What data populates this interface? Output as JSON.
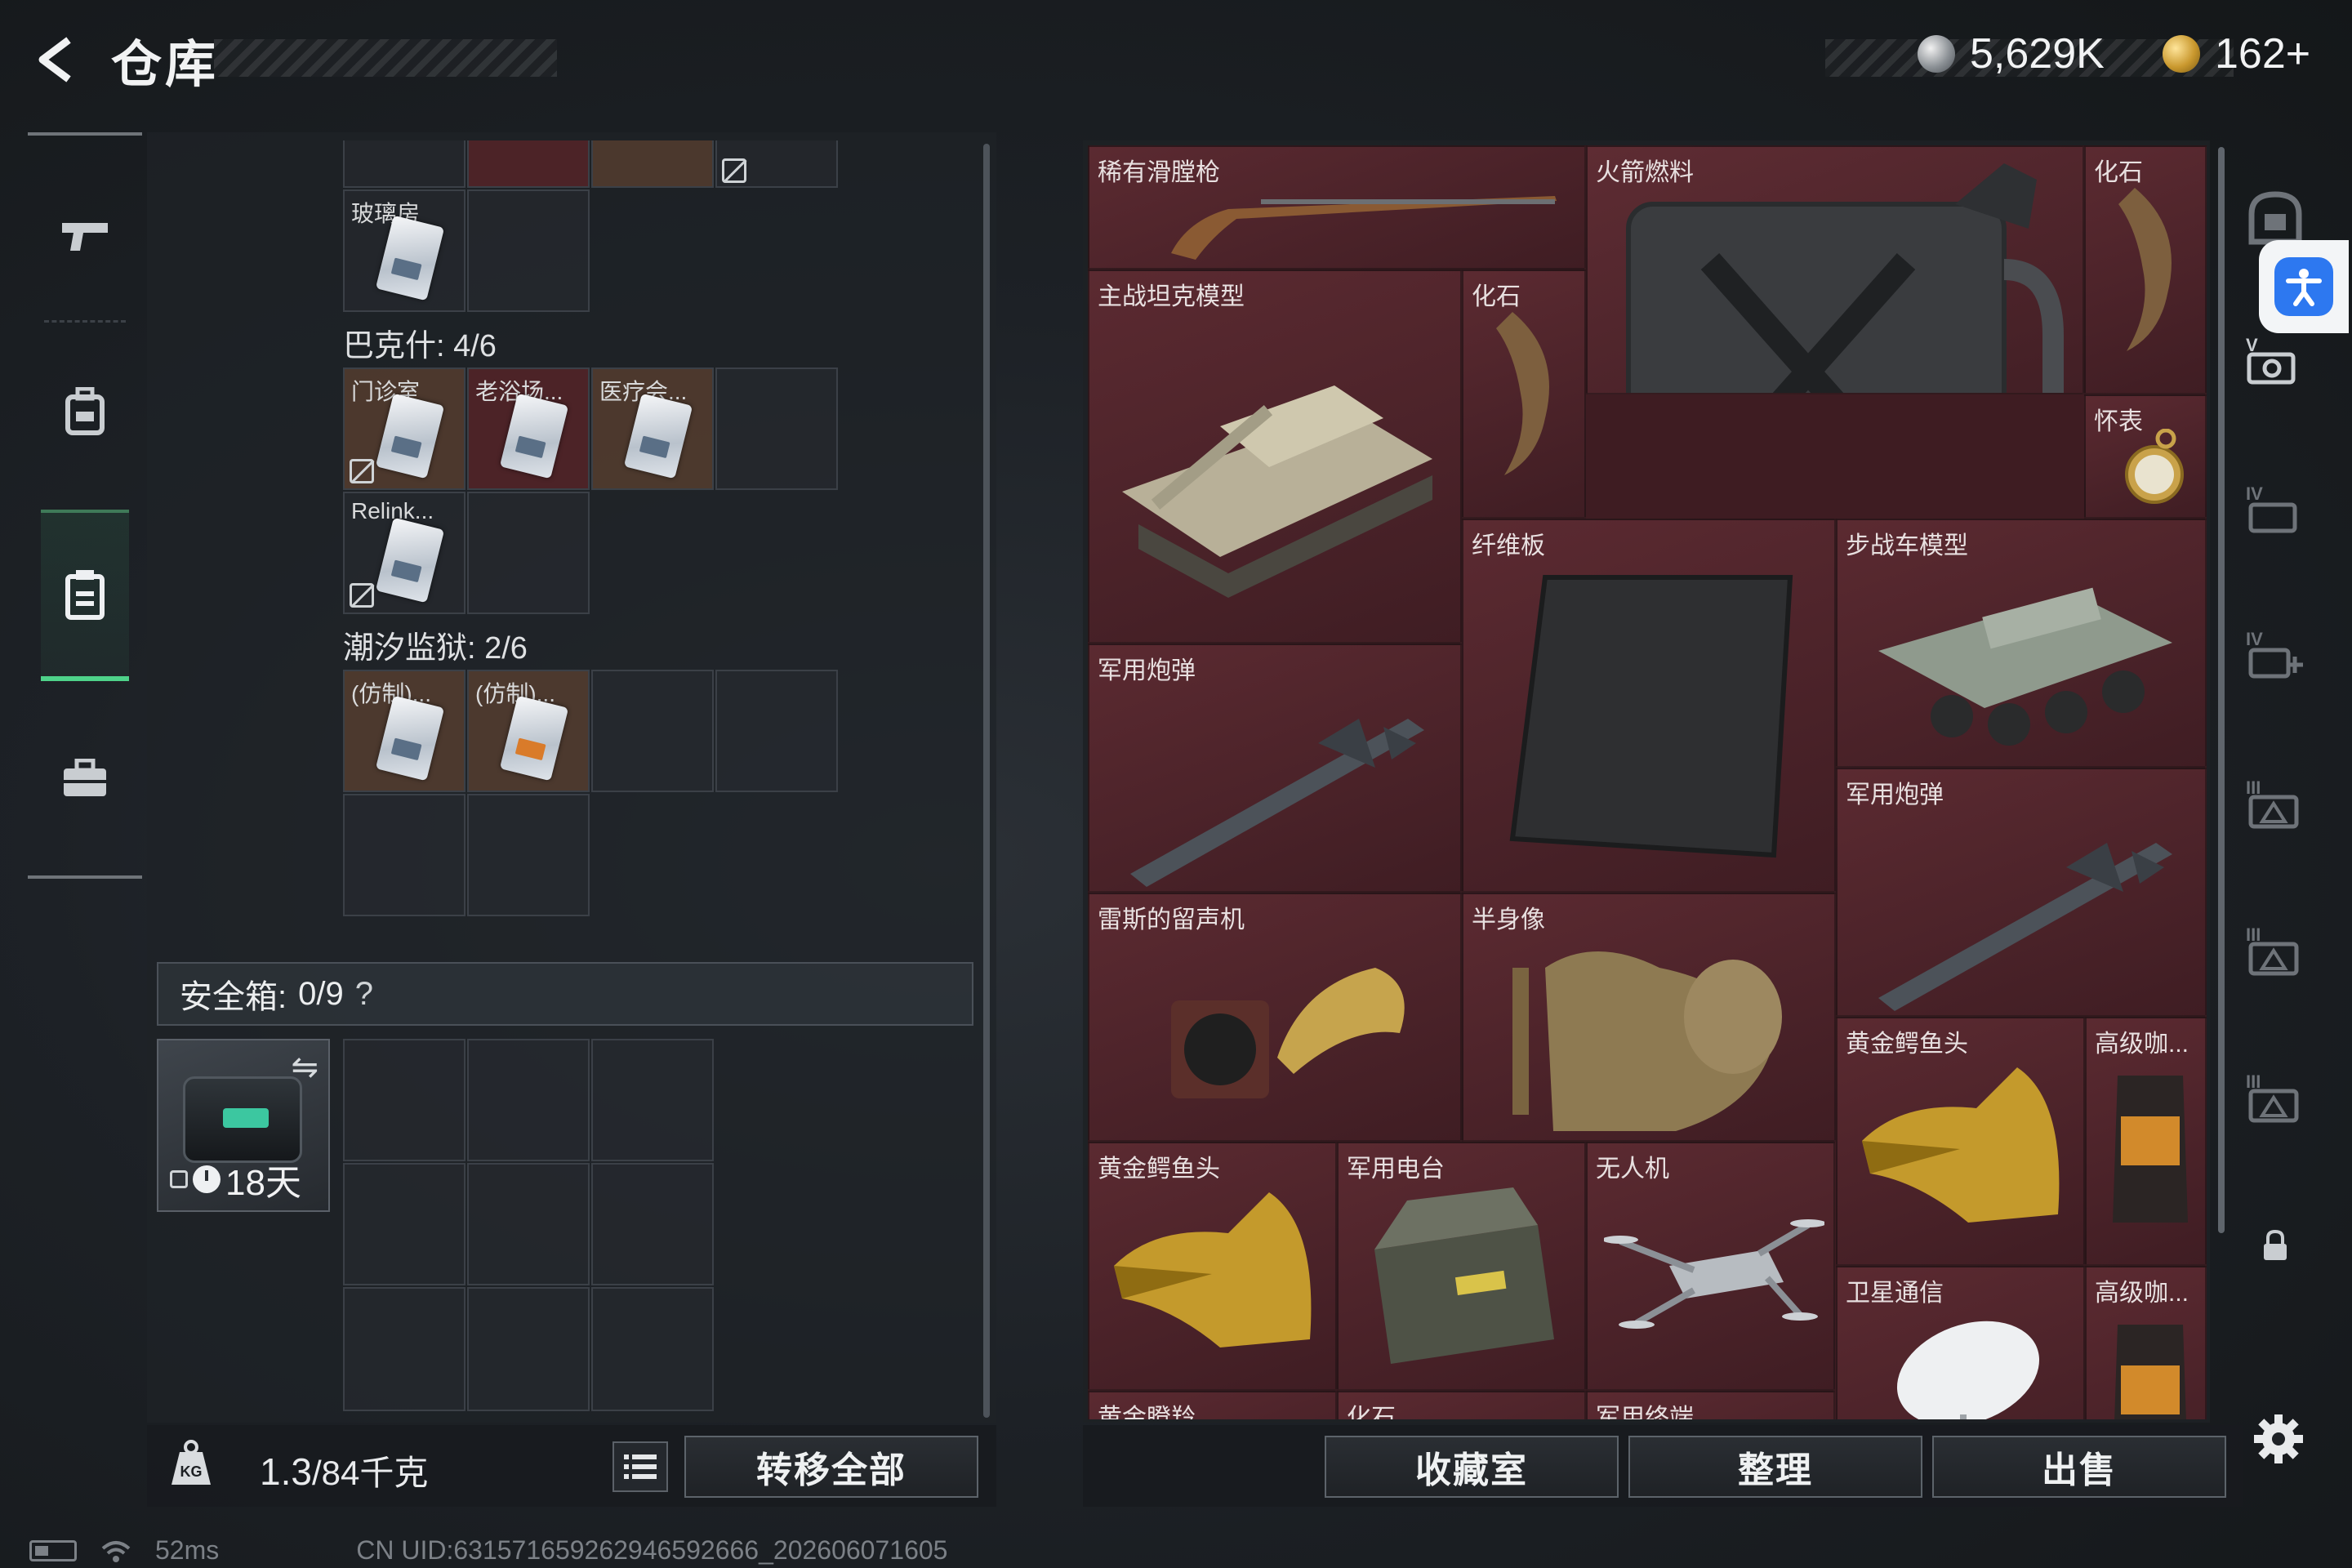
{
  "header": {
    "title": "仓库",
    "currency": [
      {
        "icon": "silver-coin-icon",
        "value": "5,629K"
      },
      {
        "icon": "gold-coin-icon",
        "value": "162+"
      }
    ]
  },
  "left_nav": {
    "items": [
      {
        "name": "weapons",
        "icon": "gun-icon"
      },
      {
        "name": "gear",
        "icon": "backpack-icon"
      },
      {
        "name": "storage",
        "icon": "clipboard-icon",
        "active": true
      },
      {
        "name": "cases",
        "icon": "briefcase-icon"
      }
    ]
  },
  "keycards": {
    "top_row": [
      {
        "label": "玻璃房",
        "color": "plain"
      }
    ],
    "groups": [
      {
        "title": "巴克什: 4/6",
        "slots": [
          {
            "label": "门诊室",
            "color": "brown",
            "locked_icon": true
          },
          {
            "label": "老浴场...",
            "color": "red",
            "locked_icon": false
          },
          {
            "label": "医疗会...",
            "color": "brown",
            "locked_icon": false
          },
          {
            "label": "",
            "color": "plain"
          },
          {
            "label": "Relink...",
            "color": "plain",
            "locked_icon": true
          }
        ]
      },
      {
        "title": "潮汐监狱: 2/6",
        "slots": [
          {
            "label": "(仿制)...",
            "color": "brown"
          },
          {
            "label": "(仿制)...",
            "color": "brown",
            "card_color": "orange"
          }
        ]
      }
    ]
  },
  "safe_box": {
    "label": "安全箱:",
    "count": "0/9",
    "help": "?",
    "timer": "18天"
  },
  "bottom_left": {
    "weight_current": "1.3",
    "weight_rest": "/84千克",
    "transfer_all": "转移全部"
  },
  "storage_items": [
    {
      "label": "稀有滑膛枪",
      "icon": "musket-icon"
    },
    {
      "label": "火箭燃料",
      "icon": "jerrycan-icon"
    },
    {
      "label": "化石",
      "icon": "fossil-claw-icon"
    },
    {
      "label": "主战坦克模型",
      "icon": "tank-model-icon"
    },
    {
      "label": "化石",
      "icon": "fossil-claw-icon"
    },
    {
      "label": "怀表",
      "icon": "pocket-watch-icon"
    },
    {
      "label": "纤维板",
      "icon": "carbon-board-icon"
    },
    {
      "label": "步战车模型",
      "icon": "ifv-model-icon"
    },
    {
      "label": "军用炮弹",
      "icon": "missile-icon"
    },
    {
      "label": "军用炮弹",
      "icon": "missile-icon"
    },
    {
      "label": "雷斯的留声机",
      "icon": "gramophone-icon"
    },
    {
      "label": "半身像",
      "icon": "bust-icon"
    },
    {
      "label": "黄金鳄鱼头",
      "icon": "gold-croc-head-icon"
    },
    {
      "label": "高级咖...",
      "icon": "coffee-bag-icon"
    },
    {
      "label": "黄金鳄鱼头",
      "icon": "gold-croc-head-icon"
    },
    {
      "label": "军用电台",
      "icon": "radio-icon"
    },
    {
      "label": "无人机",
      "icon": "drone-icon"
    },
    {
      "label": "卫星通信",
      "icon": "satellite-dish-icon"
    },
    {
      "label": "高级咖...",
      "icon": "coffee-bag-icon"
    },
    {
      "label": "黄金瞪羚",
      "icon": ""
    },
    {
      "label": "化石",
      "icon": ""
    },
    {
      "label": "军用终端",
      "icon": ""
    }
  ],
  "bottom_right": {
    "collection": "收藏室",
    "organize": "整理",
    "sell": "出售"
  },
  "right_tabs": [
    "vault-icon",
    "tier-v-icon",
    "tier-iv-icon",
    "tier-iv-plus-icon",
    "tier-iii-icon",
    "tier-iii-icon",
    "tier-iii-icon",
    "lock-icon"
  ],
  "status": {
    "ping": "52ms",
    "uid": "CN UID:631571659262946592666_202606071605"
  },
  "colors": {
    "accent_green": "#4ed38a",
    "storage_red": "#5b2a31",
    "accessibility_blue": "#2d78f0"
  }
}
